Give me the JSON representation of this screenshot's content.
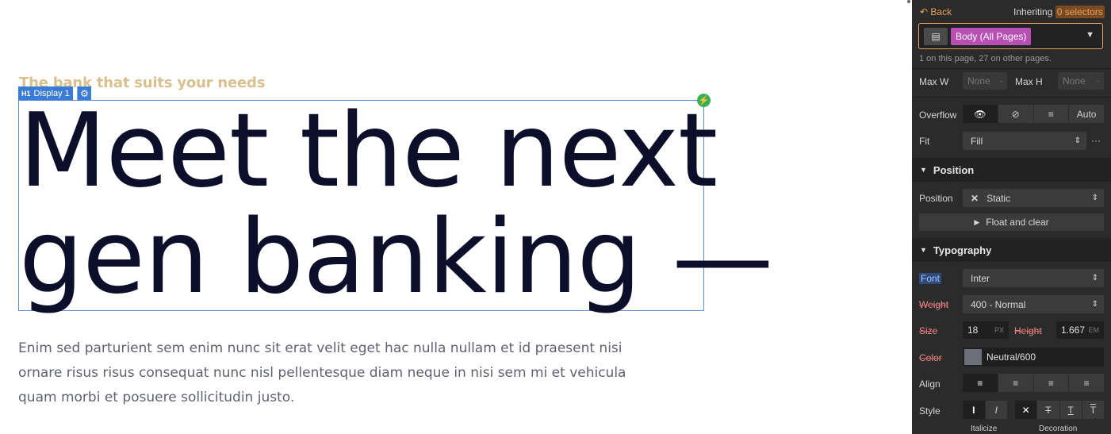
{
  "canvas": {
    "eyebrow": "The bank that suits your needs",
    "selection_tag": "Display 1",
    "selection_tag_glyph": "H1",
    "headline_line1": "Meet the next",
    "headline_line2": "gen banking —",
    "paragraph": "Enim sed parturient sem enim nunc sit erat velit eget hac nulla nullam et id praesent nisi ornare risus risus consequat nunc nisl pellentesque diam neque in nisi sem mi et vehicula quam morbi et posuere sollicitudin justo."
  },
  "panel": {
    "back_label": "Back",
    "inheriting_label": "Inheriting",
    "inheriting_count": "0 selectors",
    "selector_name": "Body (All Pages)",
    "selector_count_text": "1 on this page, 27 on other pages.",
    "max_w_label": "Max W",
    "max_w_value": "None",
    "max_h_label": "Max H",
    "max_h_value": "None",
    "overflow_label": "Overflow",
    "overflow_auto": "Auto",
    "fit_label": "Fit",
    "fit_value": "Fill",
    "position_section": "Position",
    "position_label": "Position",
    "position_value": "Static",
    "float_clear": "Float and clear",
    "typography_section": "Typography",
    "font_label": "Font",
    "font_value": "Inter",
    "weight_label": "Weight",
    "weight_value": "400 - Normal",
    "size_label": "Size",
    "size_value": "18",
    "size_unit": "PX",
    "height_label": "Height",
    "height_value": "1.667",
    "height_unit": "EM",
    "color_label": "Color",
    "color_value": "Neutral/600",
    "align_label": "Align",
    "style_label": "Style",
    "italicize_caption": "Italicize",
    "decoration_caption": "Decoration"
  },
  "colors": {
    "accent": "#3a7bd5",
    "eyebrow": "#d8c08f",
    "headline": "#0b0f2a",
    "selector_pill": "#b84fb4",
    "back_orange": "#e7a05c"
  }
}
